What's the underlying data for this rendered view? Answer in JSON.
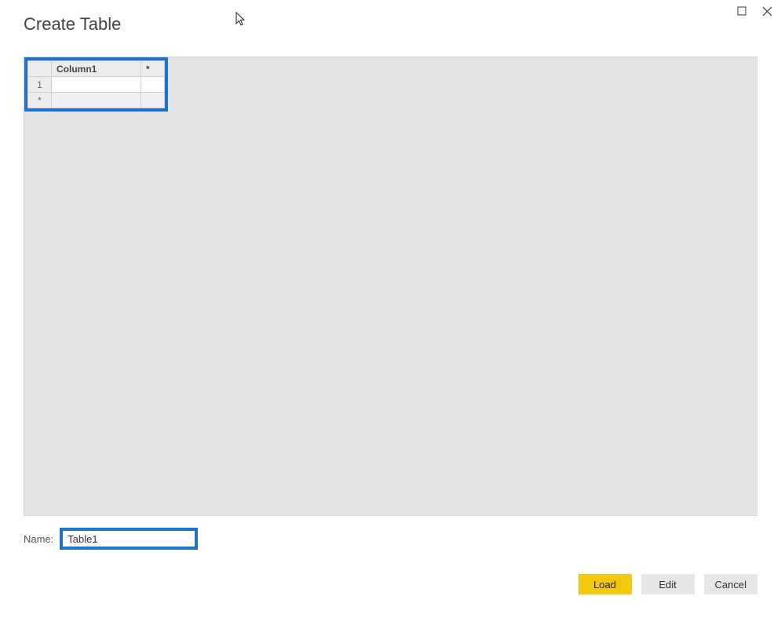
{
  "dialog": {
    "title": "Create Table"
  },
  "grid": {
    "columns": [
      "Column1"
    ],
    "addColumnLabel": "*",
    "rows": [
      {
        "num": "1",
        "cells": [
          ""
        ]
      },
      {
        "num": "*",
        "cells": [
          ""
        ]
      }
    ]
  },
  "name": {
    "label": "Name:",
    "value": "Table1"
  },
  "buttons": {
    "load": "Load",
    "edit": "Edit",
    "cancel": "Cancel"
  }
}
